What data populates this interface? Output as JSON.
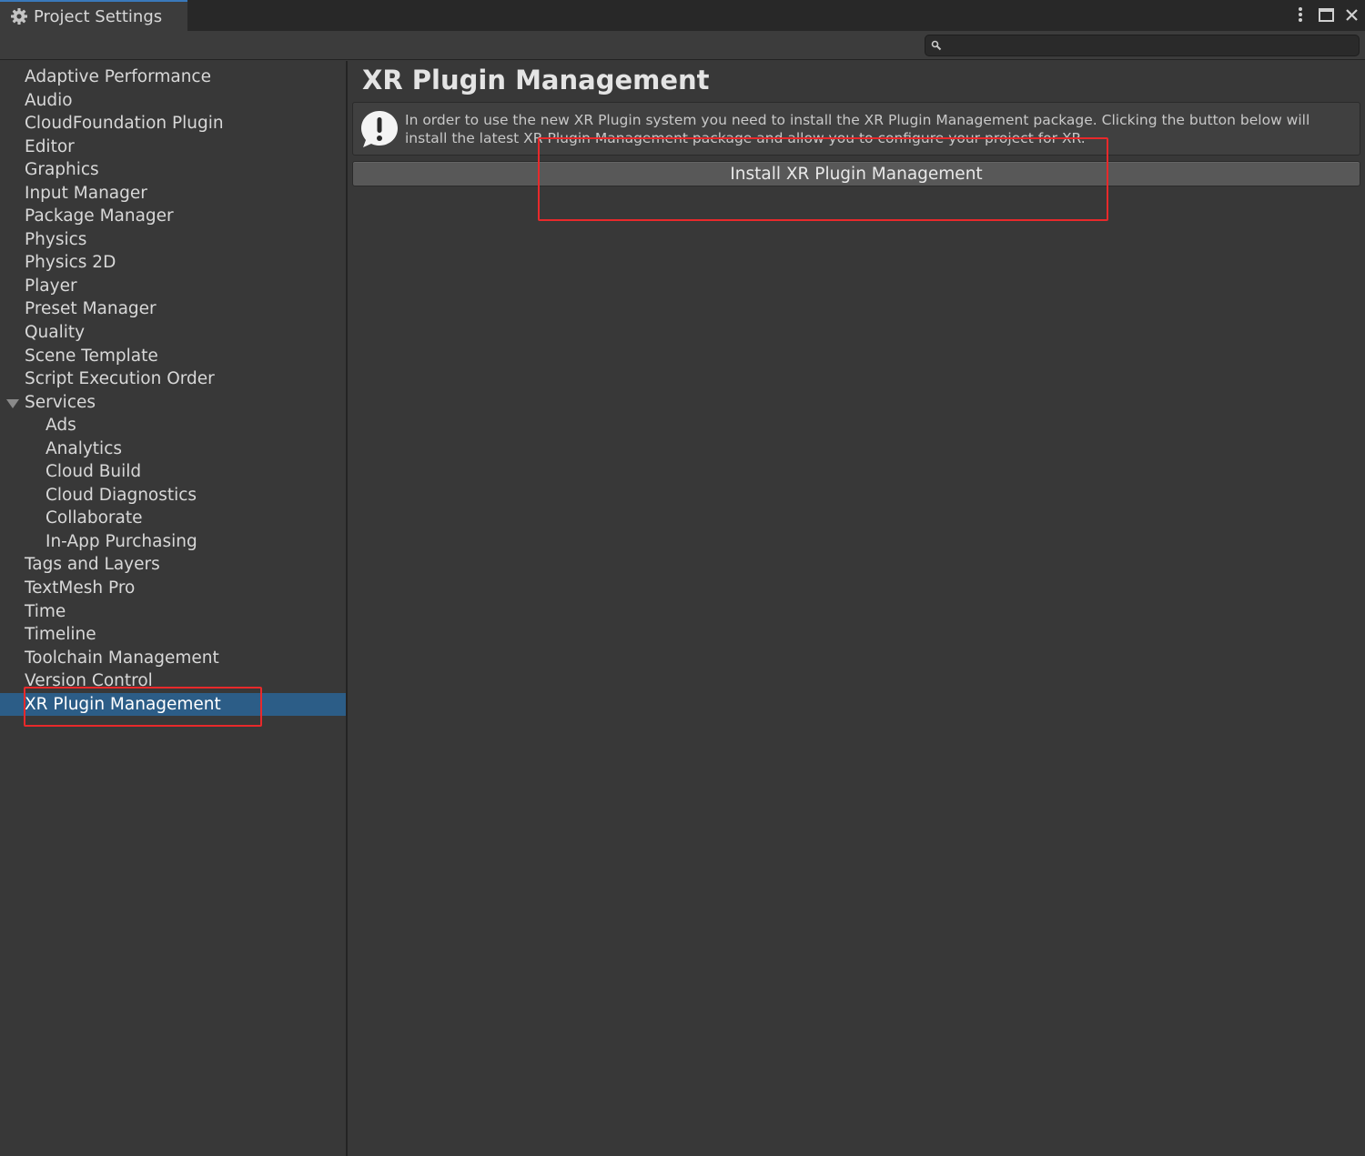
{
  "window": {
    "tab_title": "Project Settings",
    "controls": [
      "more-options",
      "maximize",
      "close"
    ]
  },
  "search": {
    "placeholder": "",
    "value": ""
  },
  "sidebar": {
    "items": [
      {
        "label": "Adaptive Performance",
        "level": 0
      },
      {
        "label": "Audio",
        "level": 0
      },
      {
        "label": "CloudFoundation Plugin",
        "level": 0
      },
      {
        "label": "Editor",
        "level": 0
      },
      {
        "label": "Graphics",
        "level": 0
      },
      {
        "label": "Input Manager",
        "level": 0
      },
      {
        "label": "Package Manager",
        "level": 0
      },
      {
        "label": "Physics",
        "level": 0
      },
      {
        "label": "Physics 2D",
        "level": 0
      },
      {
        "label": "Player",
        "level": 0
      },
      {
        "label": "Preset Manager",
        "level": 0
      },
      {
        "label": "Quality",
        "level": 0
      },
      {
        "label": "Scene Template",
        "level": 0
      },
      {
        "label": "Script Execution Order",
        "level": 0
      },
      {
        "label": "Services",
        "level": 0,
        "expanded": true
      },
      {
        "label": "Ads",
        "level": 1
      },
      {
        "label": "Analytics",
        "level": 1
      },
      {
        "label": "Cloud Build",
        "level": 1
      },
      {
        "label": "Cloud Diagnostics",
        "level": 1
      },
      {
        "label": "Collaborate",
        "level": 1
      },
      {
        "label": "In-App Purchasing",
        "level": 1
      },
      {
        "label": "Tags and Layers",
        "level": 0
      },
      {
        "label": "TextMesh Pro",
        "level": 0
      },
      {
        "label": "Time",
        "level": 0
      },
      {
        "label": "Timeline",
        "level": 0
      },
      {
        "label": "Toolchain Management",
        "level": 0
      },
      {
        "label": "Version Control",
        "level": 0
      },
      {
        "label": "XR Plugin Management",
        "level": 0,
        "selected": true
      }
    ]
  },
  "main": {
    "title": "XR Plugin Management",
    "help_message": "In order to use the new XR Plugin system you need to install the XR Plugin Management package. Clicking the button below will install the latest XR Plugin Management package and allow you to configure your project for XR.",
    "help_icon": "warning-exclamation-icon",
    "install_button": "Install XR Plugin Management"
  },
  "colors": {
    "background": "#383838",
    "selection": "#2c5d87",
    "annotation": "#e8292b"
  }
}
